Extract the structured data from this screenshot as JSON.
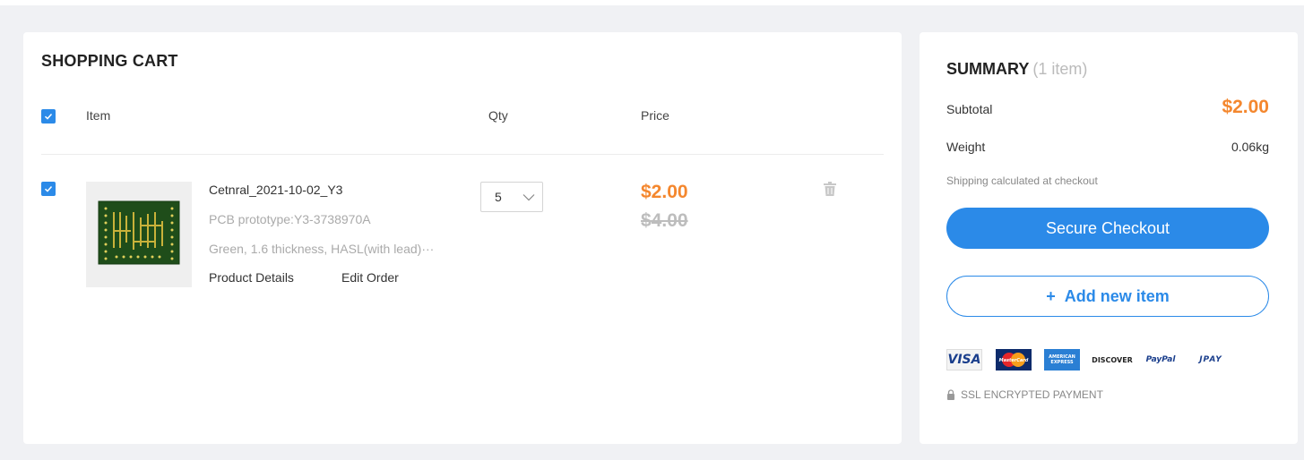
{
  "cart": {
    "title": "SHOPPING CART",
    "columns": {
      "item": "Item",
      "qty": "Qty",
      "price": "Price"
    },
    "select_all_checked": true,
    "items": [
      {
        "checked": true,
        "name": "Cetnral_2021-10-02_Y3",
        "subtitle": "PCB prototype:Y3-3738970A",
        "specs": "Green, 1.6 thickness, HASL(with lead)···",
        "links": {
          "details": "Product Details",
          "edit": "Edit Order"
        },
        "qty": "5",
        "price": "$2.00",
        "original_price": "$4.00",
        "thumbnail_icon": "pcb-board-icon",
        "delete_icon": "trash-icon"
      }
    ]
  },
  "summary": {
    "title": "SUMMARY",
    "count": "(1 item)",
    "subtotal_label": "Subtotal",
    "subtotal_value": "$2.00",
    "weight_label": "Weight",
    "weight_value": "0.06kg",
    "shipping_note": "Shipping calculated at checkout",
    "checkout_label": "Secure Checkout",
    "add_label": "Add new item",
    "add_icon": "plus-icon",
    "payment_methods": [
      "VISA",
      "MasterCard",
      "AMERICAN EXPRESS",
      "DISCOVER",
      "PayPal",
      "JPAY"
    ],
    "ssl_label": "SSL ENCRYPTED PAYMENT",
    "ssl_icon": "lock-icon"
  },
  "colors": {
    "accent": "#2b8ae8",
    "price": "#f4872e",
    "strike": "#bdbdbd",
    "background": "#f0f1f4"
  }
}
